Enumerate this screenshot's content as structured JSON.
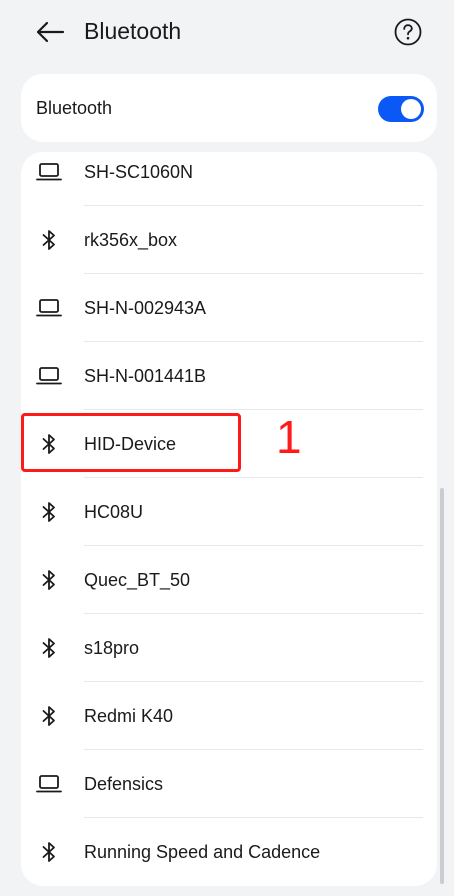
{
  "header": {
    "title": "Bluetooth",
    "back_icon": "arrow-left-icon",
    "help_icon": "question-circle-icon"
  },
  "toggle_card": {
    "label": "Bluetooth",
    "enabled": true,
    "accent": "#0a59f7"
  },
  "devices": [
    {
      "name": "SH-SC1060N",
      "icon": "laptop-icon"
    },
    {
      "name": "rk356x_box",
      "icon": "bluetooth-icon"
    },
    {
      "name": "SH-N-002943A",
      "icon": "laptop-icon"
    },
    {
      "name": "SH-N-001441B",
      "icon": "laptop-icon"
    },
    {
      "name": "HID-Device",
      "icon": "bluetooth-icon"
    },
    {
      "name": "HC08U",
      "icon": "bluetooth-icon"
    },
    {
      "name": "Quec_BT_50",
      "icon": "bluetooth-icon"
    },
    {
      "name": "s18pro",
      "icon": "bluetooth-icon"
    },
    {
      "name": "Redmi K40",
      "icon": "bluetooth-icon"
    },
    {
      "name": "Defensics",
      "icon": "laptop-icon"
    },
    {
      "name": "Running Speed and Cadence",
      "icon": "bluetooth-icon"
    }
  ],
  "annotation": {
    "label": "1",
    "color": "#ff1a1a"
  }
}
